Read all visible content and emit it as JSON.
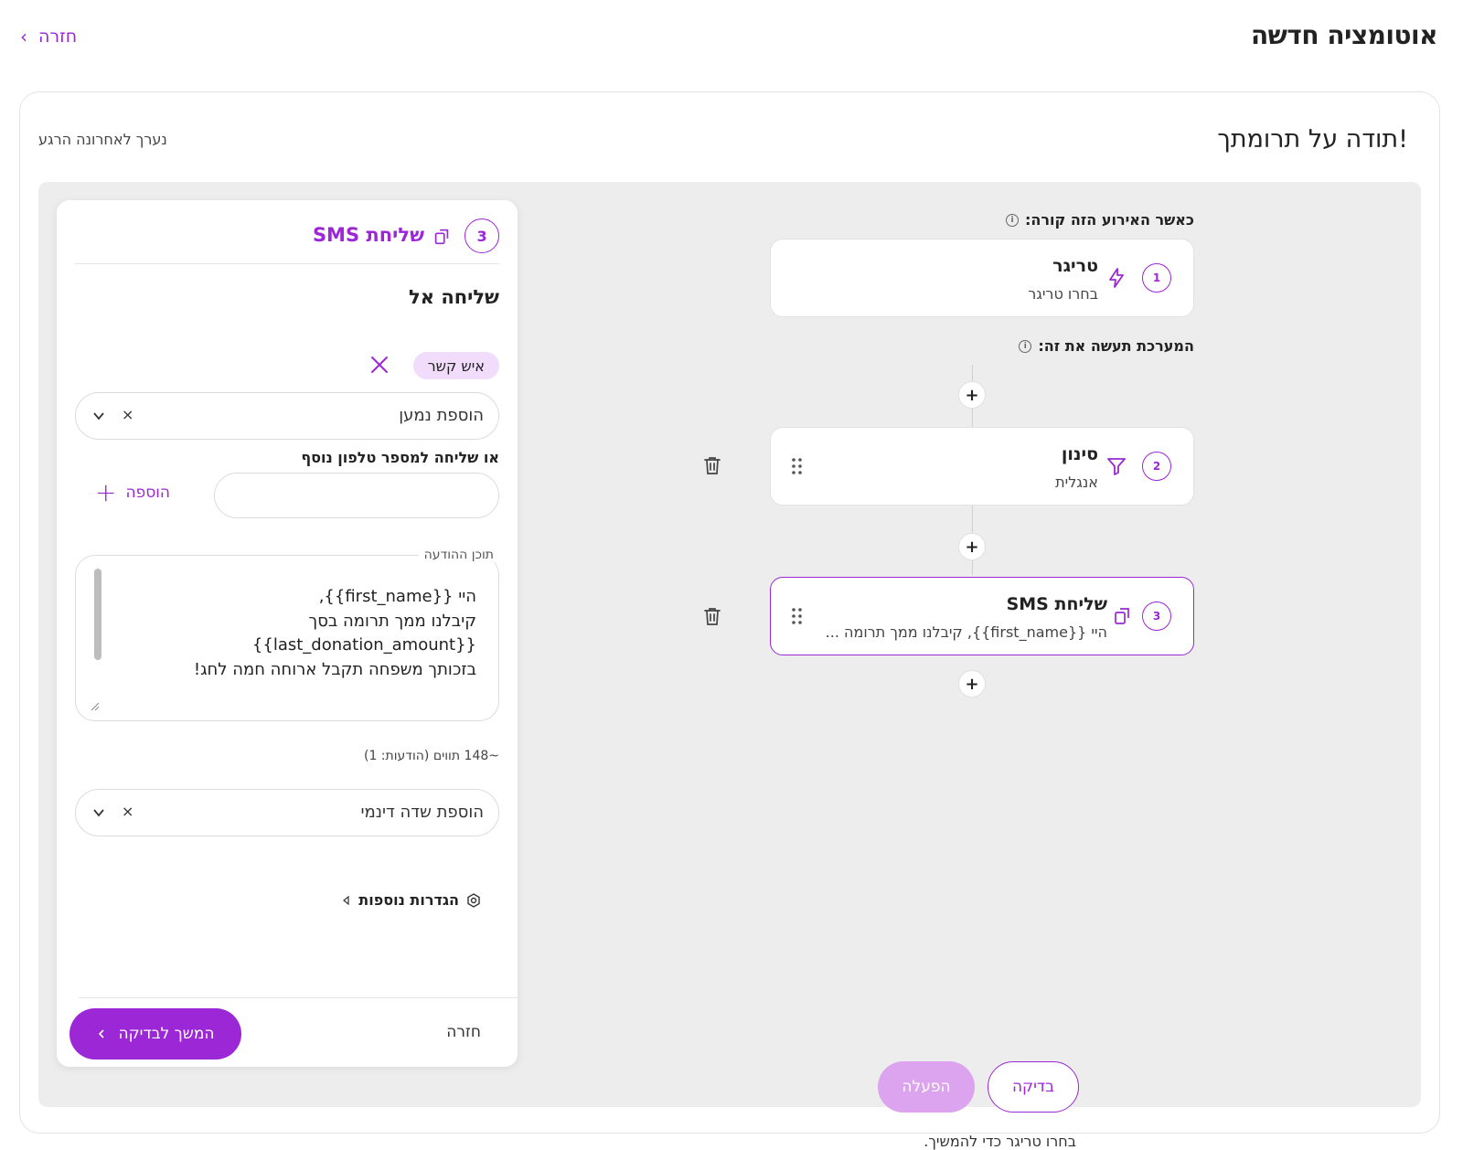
{
  "header": {
    "title": "אוטומציה חדשה",
    "back_label": "חזרה"
  },
  "automation": {
    "name": "תודה על תרומתך!",
    "save_status": "נערך לאחרונה הרגע"
  },
  "flow": {
    "trigger_label": "כאשר האירוע הזה קורה:",
    "actions_label": "המערכת תעשה את זה:",
    "nodes": [
      {
        "num": "1",
        "title": "טריגר",
        "subtitle": "בחרו טריגר"
      },
      {
        "num": "2",
        "title": "סינון",
        "subtitle": "אנגלית"
      },
      {
        "num": "3",
        "title": "שליחת SMS",
        "subtitle": "היי {{first_name}}, קיבלנו ממך תרומה ..."
      }
    ],
    "plus_symbol": "+",
    "test_button": "בדיקה",
    "activate_button": "הפעלה",
    "hint": "בחרו טריגר כדי להמשיך."
  },
  "panel": {
    "step_num": "3",
    "title": "שליחת SMS",
    "send_to_title": "שליחה אל",
    "recipient_chip": "איש קשר",
    "add_recipient_placeholder": "הוספת נמען",
    "clear_symbol": "×",
    "extra_phone_label": "או שליחה למספר טלפון נוסף",
    "add_label": "הוספה",
    "add_symbol": "+",
    "message_legend": "תוכן ההודעה",
    "message_text": "היי {{first_name}},\nקיבלנו ממך תרומה בסך\n{{last_donation_amount}}\nבזכותך משפחה תקבל ארוחה חמה לחג!",
    "char_count": "~148 תווים (הודעות: 1)",
    "dynamic_field_placeholder": "הוספת שדה דינמי",
    "more_settings": "הגדרות נוספות",
    "back_label": "חזרה",
    "continue_label": "המשך לבדיקה"
  },
  "colors": {
    "accent": "#9b27d6",
    "accent_light": "#f1ddfb",
    "activate_disabled": "#dca3ee"
  }
}
